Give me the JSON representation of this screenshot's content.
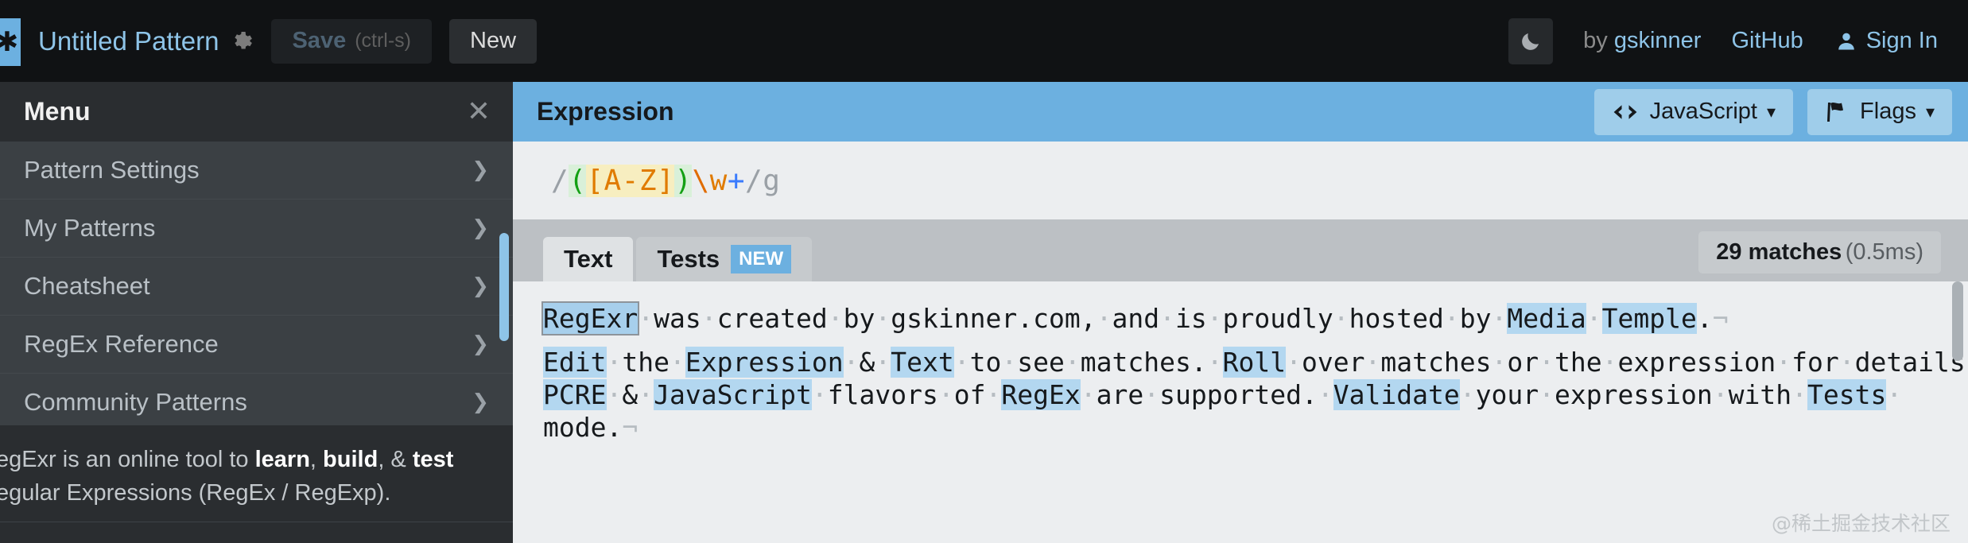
{
  "topbar": {
    "logo_icon": "regexr-asterisk-logo",
    "pattern_title": "Untitled Pattern",
    "gear_icon": "gear-icon",
    "save_label": "Save",
    "save_hint": "(ctrl-s)",
    "new_label": "New",
    "theme_icon": "moon-icon",
    "by_prefix": "by ",
    "by_name": "gskinner",
    "github_label": "GitHub",
    "signin_icon": "person-icon",
    "signin_label": "Sign In"
  },
  "sidebar": {
    "title": "Menu",
    "close_icon": "close-icon",
    "chevron_icon": "chevron-right-icon",
    "items": [
      {
        "label": "Pattern Settings"
      },
      {
        "label": "My Patterns"
      },
      {
        "label": "Cheatsheet"
      },
      {
        "label": "RegEx Reference"
      },
      {
        "label": "Community Patterns"
      }
    ],
    "info_line1_a": "RegExr is an online tool to ",
    "info_line1_b": "learn",
    "info_line1_c": ", ",
    "info_line1_d": "build",
    "info_line1_e": ", & ",
    "info_line1_f": "test",
    "info_line2": "Regular Expressions (RegEx / RegExp)."
  },
  "expression": {
    "title": "Expression",
    "flavor_icon": "code-brackets-icon",
    "flavor_label": "JavaScript",
    "flavor_caret": "▾",
    "flags_icon": "flag-icon",
    "flags_label": "Flags",
    "flags_caret": "▾",
    "pattern": "/([A-Z])\\w+/g",
    "tokens": {
      "open_slash": "/",
      "group_open": "(",
      "set": "[A-Z]",
      "group_close": ")",
      "escape": "\\",
      "escape_char": "w",
      "quantifier": "+",
      "close_slash": "/",
      "flags": "g"
    }
  },
  "tabs": {
    "text_label": "Text",
    "tests_label": "Tests",
    "tests_badge": "NEW",
    "active": "Text"
  },
  "matches": {
    "count_label": "29 matches",
    "time_label": "(0.5ms)"
  },
  "text_content": {
    "line1": [
      {
        "t": "RegExr",
        "m": "hover"
      },
      {
        "t": " was created by gskinner.com, and is proudly hosted by "
      },
      {
        "t": "Media",
        "m": "match"
      },
      {
        "t": " "
      },
      {
        "t": "Temple",
        "m": "match"
      },
      {
        "t": "."
      },
      {
        "t": "¬",
        "m": "cr"
      }
    ],
    "line2": [
      {
        "t": "Edit",
        "m": "match"
      },
      {
        "t": " the "
      },
      {
        "t": "Expression",
        "m": "match"
      },
      {
        "t": " & "
      },
      {
        "t": "Text",
        "m": "match"
      },
      {
        "t": " to see matches. "
      },
      {
        "t": "Roll",
        "m": "match"
      },
      {
        "t": " over matches or the expression for details. "
      }
    ],
    "line3": [
      {
        "t": "PCRE",
        "m": "match"
      },
      {
        "t": " & "
      },
      {
        "t": "JavaScript",
        "m": "match"
      },
      {
        "t": " flavors of "
      },
      {
        "t": "RegEx",
        "m": "match"
      },
      {
        "t": " are supported. "
      },
      {
        "t": "Validate",
        "m": "match"
      },
      {
        "t": " your expression with "
      },
      {
        "t": "Tests",
        "m": "match"
      },
      {
        "t": " "
      }
    ],
    "line4": [
      {
        "t": "mode."
      },
      {
        "t": "¬",
        "m": "cr"
      }
    ]
  },
  "watermark": "@稀土掘金技术社区",
  "colors": {
    "accent": "#6cb0e0",
    "topbar_bg": "#101214",
    "sidebar_bg": "#3b4044",
    "panel_bg": "#eceef0",
    "match_highlight": "#b3d7f0"
  }
}
